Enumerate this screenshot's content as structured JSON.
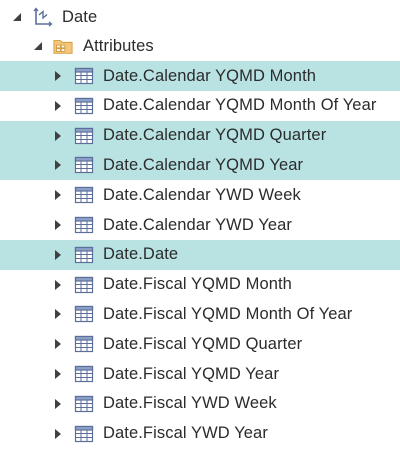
{
  "root": {
    "label": "Date",
    "icon": "hierarchy-icon",
    "expanded": true
  },
  "folder": {
    "label": "Attributes",
    "icon": "folder-icon",
    "expanded": true
  },
  "items": [
    {
      "label": "Date.Calendar YQMD Month",
      "selected": true
    },
    {
      "label": "Date.Calendar YQMD Month Of Year",
      "selected": false
    },
    {
      "label": "Date.Calendar YQMD Quarter",
      "selected": true
    },
    {
      "label": "Date.Calendar YQMD Year",
      "selected": true
    },
    {
      "label": "Date.Calendar YWD Week",
      "selected": false
    },
    {
      "label": "Date.Calendar YWD Year",
      "selected": false
    },
    {
      "label": "Date.Date",
      "selected": true
    },
    {
      "label": "Date.Fiscal YQMD Month",
      "selected": false
    },
    {
      "label": "Date.Fiscal YQMD Month Of Year",
      "selected": false
    },
    {
      "label": "Date.Fiscal YQMD Quarter",
      "selected": false
    },
    {
      "label": "Date.Fiscal YQMD Year",
      "selected": false
    },
    {
      "label": "Date.Fiscal YWD Week",
      "selected": false
    },
    {
      "label": "Date.Fiscal YWD Year",
      "selected": false
    }
  ],
  "colors": {
    "selection": "#b9e3e3",
    "text": "#2b2b2b",
    "triangle": "#404040",
    "table_icon_border": "#5b6f9a",
    "folder": "#e8b25a"
  }
}
